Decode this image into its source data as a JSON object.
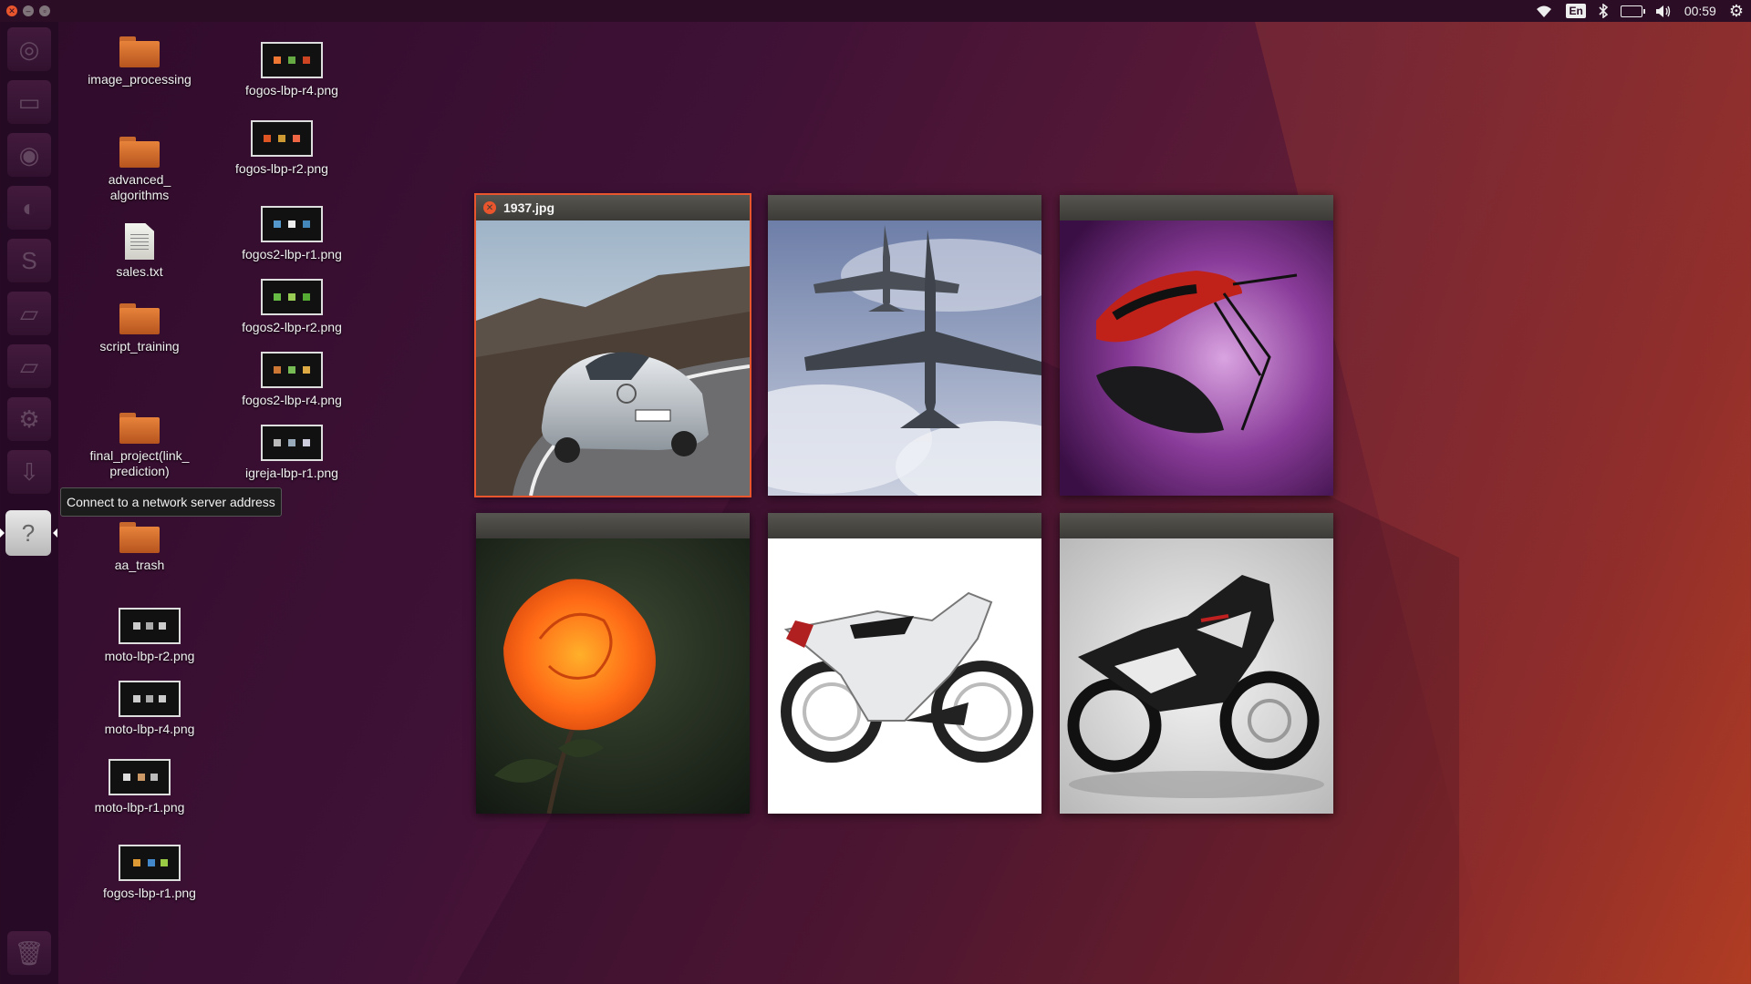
{
  "top_panel": {
    "keyboard_layout": "En",
    "clock": "00:59",
    "icons": [
      "wifi-icon",
      "keyboard-layout-indicator",
      "bluetooth-icon",
      "battery-icon",
      "volume-icon",
      "clock",
      "gear-icon"
    ]
  },
  "launcher": {
    "items": [
      "ubuntu-dash-icon",
      "files-icon",
      "chrome-icon",
      "firefox-icon",
      "libreoffice-impress-icon",
      "drive-icon",
      "drive-icon",
      "settings-icon",
      "software-updater-icon",
      "help-icon",
      "trash-icon"
    ],
    "tooltip": "Connect to a network server address"
  },
  "desktop": {
    "icons": [
      {
        "label": "image_processing",
        "type": "folder"
      },
      {
        "label": "advanced_\nalgorithms",
        "type": "folder"
      },
      {
        "label": "sales.txt",
        "type": "text"
      },
      {
        "label": "script_training",
        "type": "folder"
      },
      {
        "label": "final_project(link_\nprediction)",
        "type": "folder"
      },
      {
        "label": "aa_trash",
        "type": "folder"
      },
      {
        "label": "moto-lbp-r2.png",
        "type": "image"
      },
      {
        "label": "moto-lbp-r4.png",
        "type": "image"
      },
      {
        "label": "moto-lbp-r1.png",
        "type": "image"
      },
      {
        "label": "fogos-lbp-r1.png",
        "type": "image"
      },
      {
        "label": "fogos-lbp-r4.png",
        "type": "image"
      },
      {
        "label": "fogos-lbp-r2.png",
        "type": "image"
      },
      {
        "label": "fogos2-lbp-r1.png",
        "type": "image"
      },
      {
        "label": "fogos2-lbp-r2.png",
        "type": "image"
      },
      {
        "label": "fogos2-lbp-r4.png",
        "type": "image"
      },
      {
        "label": "igreja-lbp-r1.png",
        "type": "image"
      }
    ]
  },
  "spread": {
    "windows": [
      {
        "title": "1937.jpg",
        "subject": "silver convertible car on road"
      },
      {
        "title": "",
        "subject": "two fighter jets in clouds"
      },
      {
        "title": "",
        "subject": "red and black insects on purple"
      },
      {
        "title": "",
        "subject": "orange rose"
      },
      {
        "title": "",
        "subject": "white aprilia motorcycle"
      },
      {
        "title": "",
        "subject": "black and white sport motorcycle"
      }
    ]
  },
  "colors": {
    "accent": "#e9552c",
    "panel": "#2b0e25"
  }
}
